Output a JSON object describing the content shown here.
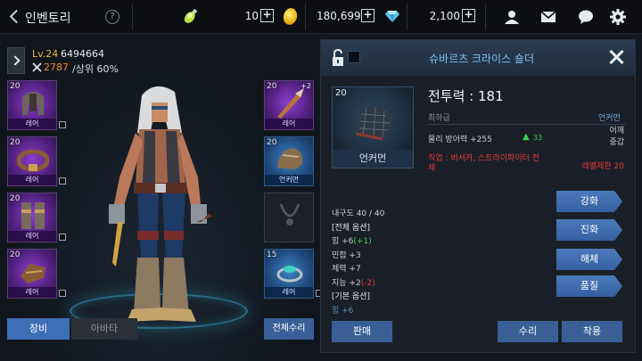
{
  "header": {
    "title": "인벤토리",
    "help_label": "?",
    "energy_value": "10",
    "gold_value": "180,699",
    "gem_value": "2,100",
    "plus_label": "+"
  },
  "character": {
    "level": "Lv.24",
    "id": "6494664",
    "power": "2787",
    "rank": "/상위 60%"
  },
  "equipment_slots": [
    {
      "level": "20",
      "grade": "레어"
    },
    {
      "level": "20",
      "grade": "레어"
    },
    {
      "level": "20",
      "grade": "레어"
    },
    {
      "level": "20",
      "grade": "레어"
    },
    {
      "level": "20",
      "grade": "레어",
      "enhance": "+2"
    },
    {
      "level": "20",
      "grade": "언커먼"
    },
    {
      "level": "",
      "grade": ""
    },
    {
      "level": "15",
      "grade": "레어"
    }
  ],
  "left_tabs": {
    "equip": "장비",
    "avatar": "아바타",
    "repair_all": "전체수리"
  },
  "item": {
    "name": "슈바르츠 크라이스 숄더",
    "level": "20",
    "type_label": "언커먼",
    "combat_power": "전투력 : 181",
    "grade": "최하급",
    "item_type": "언커먼",
    "defense": "물리 방어력 +255",
    "defense_diff": "33",
    "slot_line1": "어깨",
    "slot_line2": "중갑",
    "class_req": "직업 : 버서커, 스트라이파이터 전체",
    "level_req": "레벨제한 20"
  },
  "stats": {
    "durability": "내구도 40 / 40",
    "all_options": "[전체 옵션]",
    "str": "힘 +6",
    "str_bonus": "(+1)",
    "agi": "민첩 +3",
    "vit": "체력 +7",
    "int": "지능 +2",
    "int_bonus": "(-2)",
    "base_options": "[기본 옵션]",
    "base_str": "힘 +6"
  },
  "actions": {
    "enhance": "강화",
    "evolve": "진화",
    "dismantle": "해체",
    "quality": "품질",
    "sell": "판매",
    "repair": "수리",
    "equip": "착용"
  },
  "colors": {
    "accent": "#3d6fb6",
    "rare_purple": "#8d3fd1",
    "uncommon_blue": "#3c82c4",
    "warning_red": "#e33b3b",
    "bonus_green": "#3fd14a",
    "level_gold": "#e6b84a"
  }
}
